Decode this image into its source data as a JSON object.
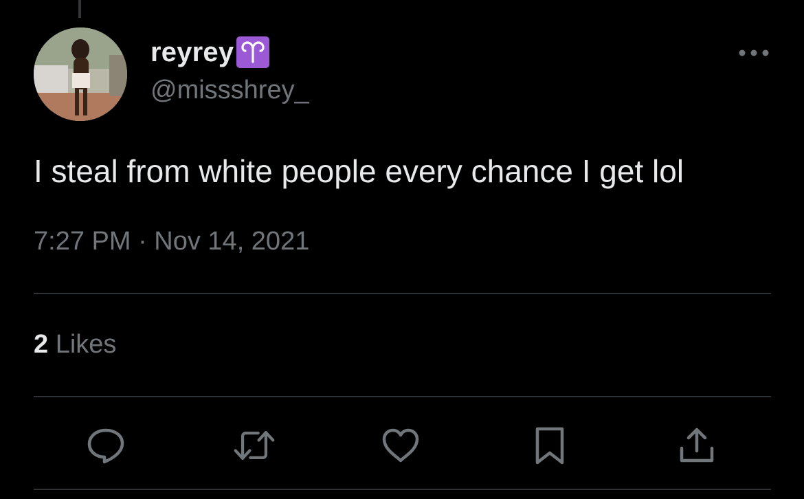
{
  "tweet": {
    "display_name": "reyrey",
    "badge": {
      "icon": "aries-zodiac-icon",
      "color": "#9b59d6"
    },
    "handle": "@missshrey_",
    "text": "I steal from white people every chance I get lol",
    "timestamp": "7:27 PM · Nov 14, 2021",
    "likes_count": "2",
    "likes_label": "Likes"
  },
  "actions": [
    {
      "name": "reply",
      "icon": "reply-bubble-icon"
    },
    {
      "name": "retweet",
      "icon": "retweet-icon"
    },
    {
      "name": "like",
      "icon": "heart-icon"
    },
    {
      "name": "bookmark",
      "icon": "bookmark-icon"
    },
    {
      "name": "share",
      "icon": "share-icon"
    }
  ],
  "colors": {
    "background": "#000000",
    "primary_text": "#e7e9ea",
    "secondary_text": "#71767b",
    "divider": "#2f3336"
  }
}
